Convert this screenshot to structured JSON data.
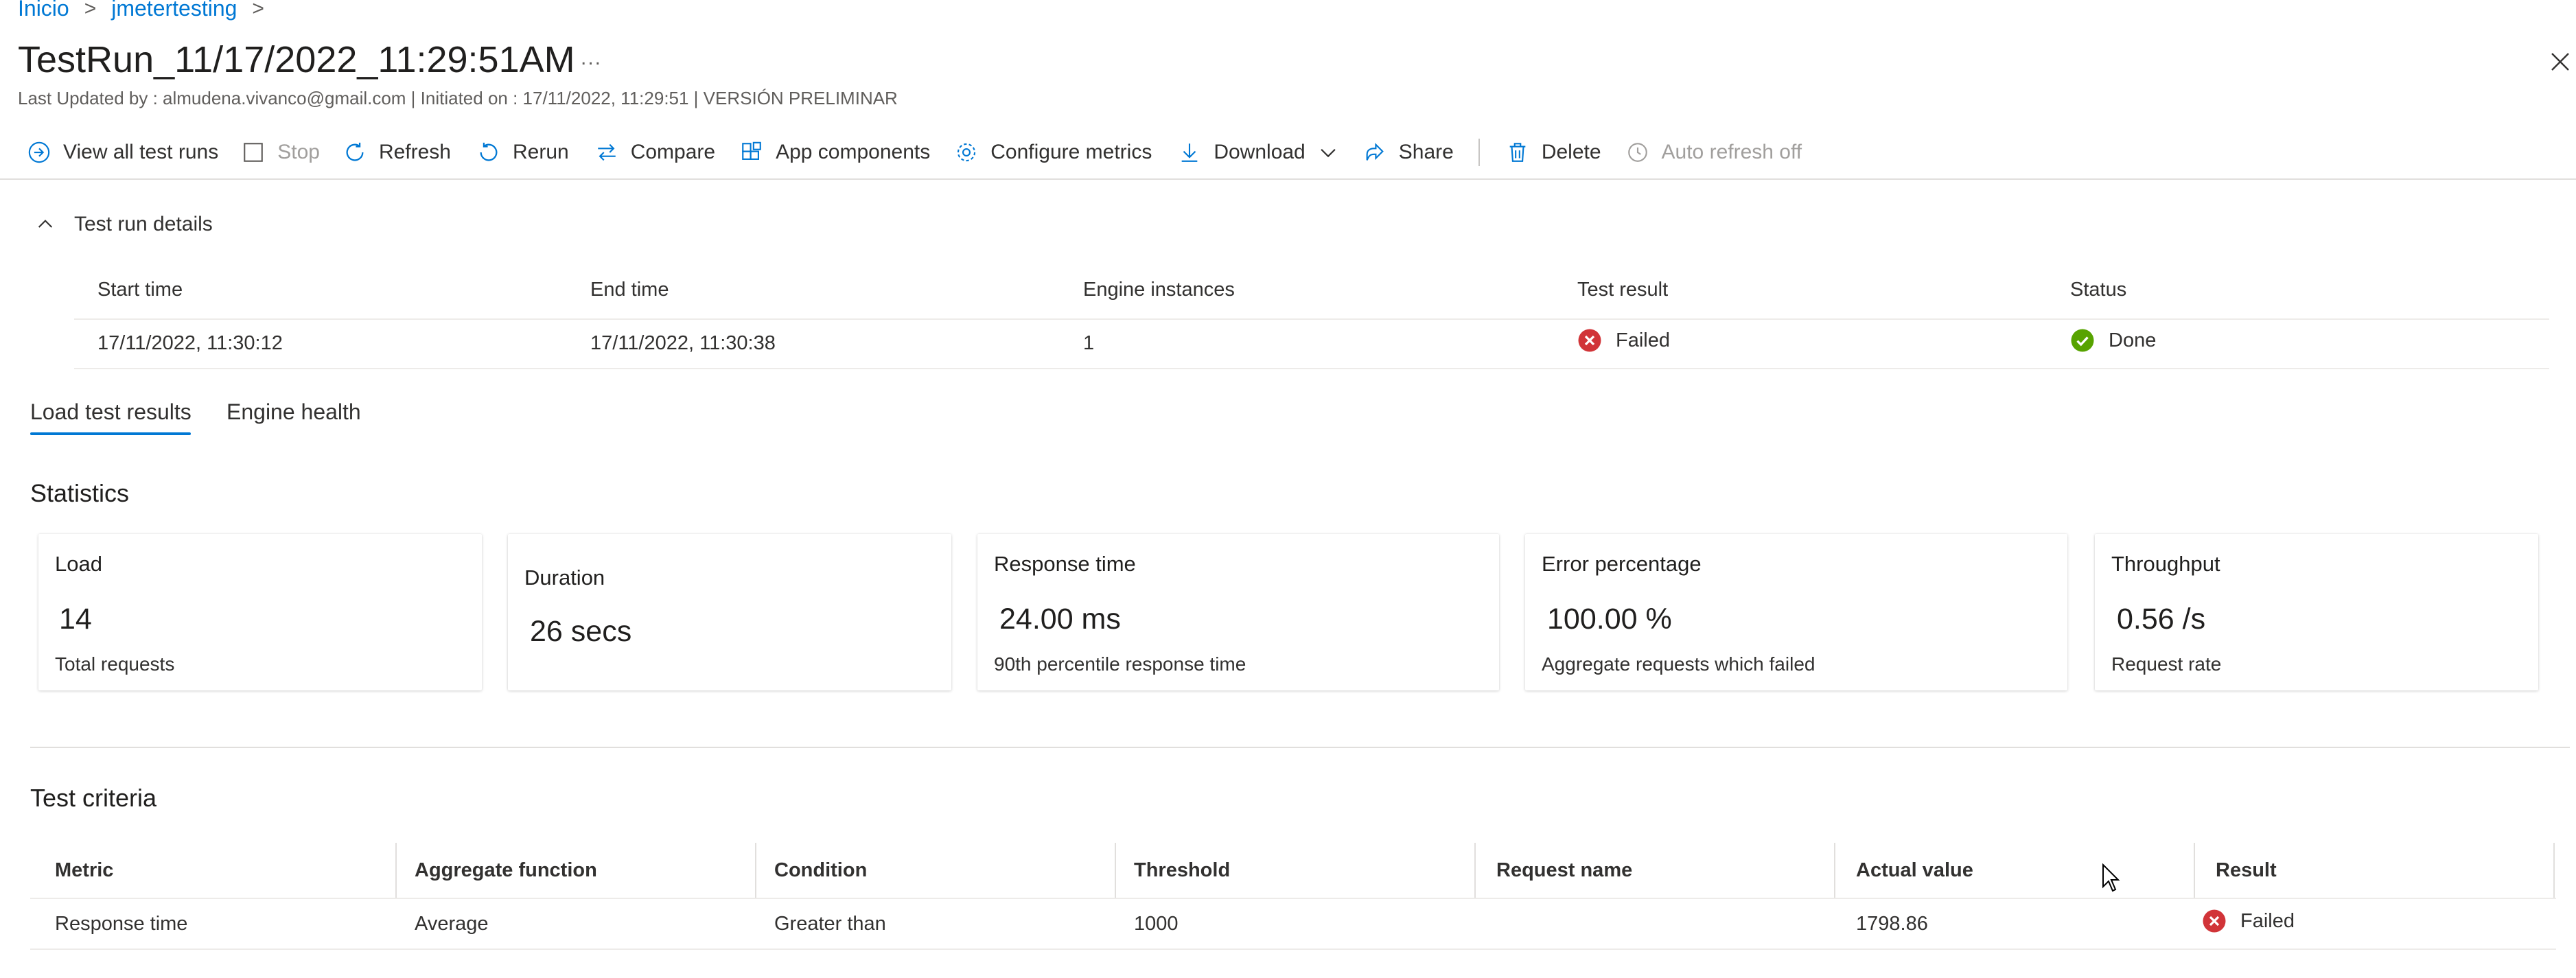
{
  "breadcrumb": {
    "items": [
      "Inicio",
      "jmetertesting"
    ]
  },
  "page": {
    "title": "TestRun_11/17/2022_11:29:51AM",
    "more_label": "...",
    "subtitle": "Last Updated by : almudena.vivanco@gmail.com | Initiated on : 17/11/2022, 11:29:51 | VERSIÓN PRELIMINAR"
  },
  "toolbar": {
    "view_all": "View all test runs",
    "stop": "Stop",
    "refresh": "Refresh",
    "rerun": "Rerun",
    "compare": "Compare",
    "app_components": "App components",
    "configure_metrics": "Configure metrics",
    "download": "Download",
    "share": "Share",
    "delete": "Delete",
    "auto_refresh": "Auto refresh off"
  },
  "details": {
    "toggle_label": "Test run details",
    "headers": [
      "Start time",
      "End time",
      "Engine instances",
      "Test result",
      "Status"
    ],
    "row": {
      "start_time": "17/11/2022, 11:30:12",
      "end_time": "17/11/2022, 11:30:38",
      "engine_instances": "1",
      "test_result": "Failed",
      "status": "Done"
    }
  },
  "tabs": {
    "load_results": "Load test results",
    "engine_health": "Engine health"
  },
  "statistics": {
    "heading": "Statistics",
    "cards": [
      {
        "title": "Load",
        "value": "14",
        "desc": "Total requests"
      },
      {
        "title": "Duration",
        "value": "26 secs",
        "desc": ""
      },
      {
        "title": "Response time",
        "value": "24.00 ms",
        "desc": "90th percentile response time"
      },
      {
        "title": "Error percentage",
        "value": "100.00 %",
        "desc": "Aggregate requests which failed"
      },
      {
        "title": "Throughput",
        "value": "0.56 /s",
        "desc": "Request rate"
      }
    ]
  },
  "criteria": {
    "heading": "Test criteria",
    "headers": [
      "Metric",
      "Aggregate function",
      "Condition",
      "Threshold",
      "Request name",
      "Actual value",
      "Result"
    ],
    "rows": [
      {
        "metric": "Response time",
        "aggregate": "Average",
        "condition": "Greater than",
        "threshold": "1000",
        "request_name": "",
        "actual": "1798.86",
        "result": "Failed"
      }
    ]
  },
  "colors": {
    "accent": "#0078d4",
    "failed": "#d13438",
    "success": "#57a300",
    "text": "#323130",
    "muted": "#605e5c"
  }
}
